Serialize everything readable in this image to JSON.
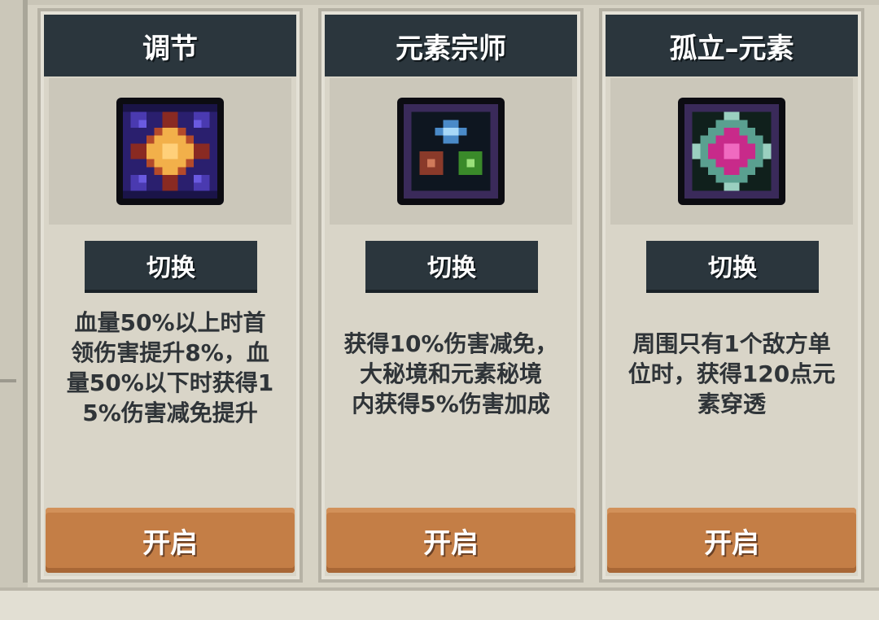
{
  "cards": [
    {
      "title": "调节",
      "icon": "regulation-icon",
      "switch_label": "切换",
      "description_lines": [
        "血量50%以上时首",
        "领伤害提升8%，血",
        "量50%以下时获得1",
        "5%伤害减免提升"
      ],
      "open_label": "开启"
    },
    {
      "title": "元素宗师",
      "icon": "element-master-icon",
      "switch_label": "切换",
      "description_lines": [
        "获得10%伤害减免，",
        "大秘境和元素秘境",
        "内获得5%伤害加成"
      ],
      "open_label": "开启"
    },
    {
      "title": "孤立–元素",
      "icon": "isolation-element-icon",
      "switch_label": "切换",
      "description_lines": [
        "周围只有1个敌方单",
        "位时，获得120点元",
        "素穿透"
      ],
      "open_label": "开启"
    }
  ],
  "colors": {
    "header_bg": "#2b363d",
    "open_button": "#c47e46",
    "panel_bg": "#d9d5c8"
  }
}
